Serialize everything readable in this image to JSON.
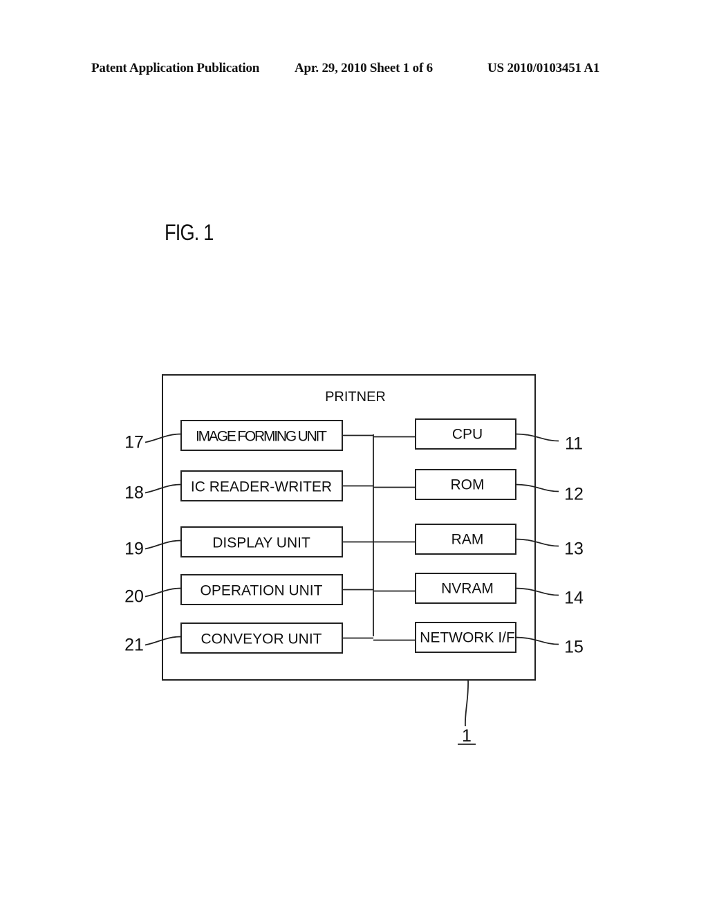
{
  "header": {
    "publication": "Patent Application Publication",
    "date_sheet": "Apr. 29, 2010  Sheet 1 of 6",
    "number": "US 2010/0103451 A1"
  },
  "figure": {
    "label": "FIG. 1",
    "container": {
      "title": "PRITNER",
      "ref": "1"
    },
    "left_units": [
      {
        "label": "IMAGE FORMING UNIT",
        "ref": "17"
      },
      {
        "label": "IC READER-WRITER",
        "ref": "18"
      },
      {
        "label": "DISPLAY UNIT",
        "ref": "19"
      },
      {
        "label": "OPERATION UNIT",
        "ref": "20"
      },
      {
        "label": "CONVEYOR UNIT",
        "ref": "21"
      }
    ],
    "right_units": [
      {
        "label": "CPU",
        "ref": "11"
      },
      {
        "label": "ROM",
        "ref": "12"
      },
      {
        "label": "RAM",
        "ref": "13"
      },
      {
        "label": "NVRAM",
        "ref": "14"
      },
      {
        "label": "NETWORK I/F",
        "ref": "15"
      }
    ]
  }
}
